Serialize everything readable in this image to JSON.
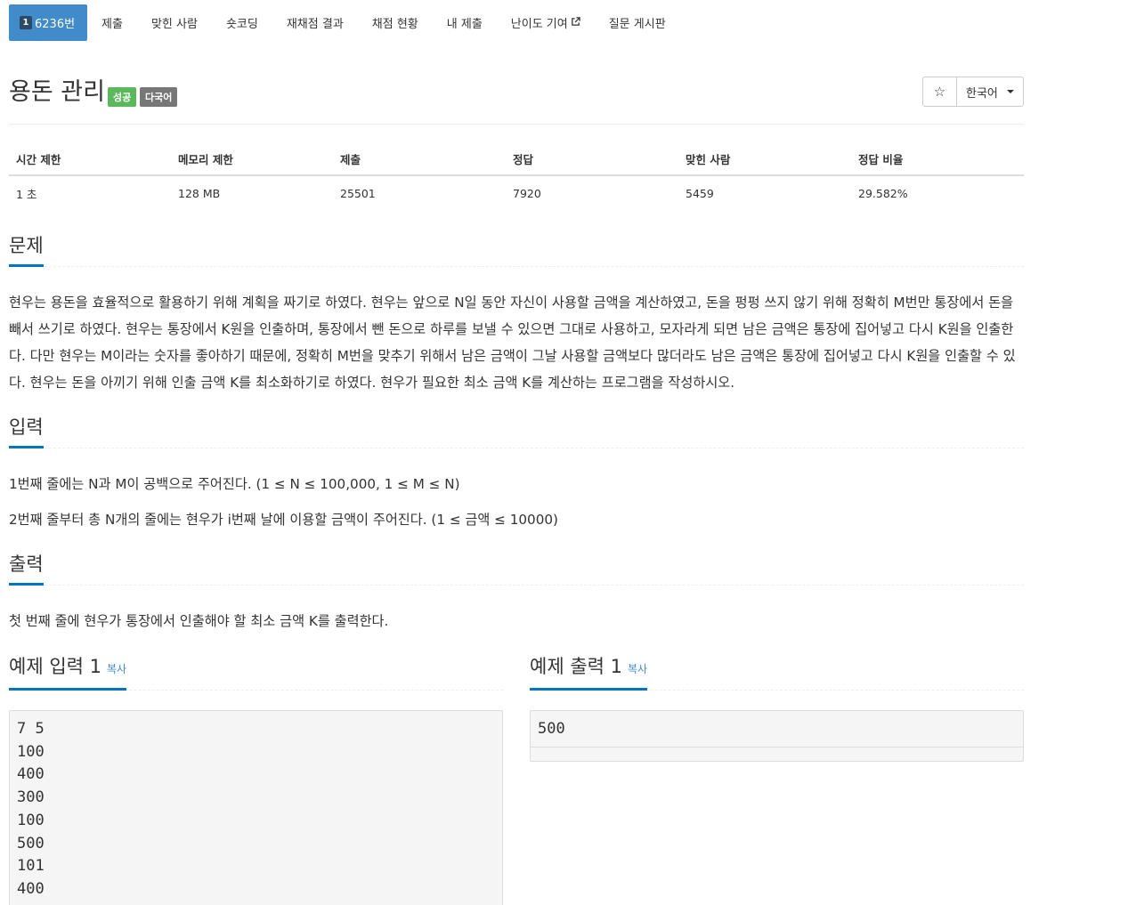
{
  "tabs": [
    {
      "label": "6236번",
      "badge": "1",
      "active": true
    },
    {
      "label": "제출"
    },
    {
      "label": "맞힌 사람"
    },
    {
      "label": "숏코딩"
    },
    {
      "label": "재채점 결과"
    },
    {
      "label": "채점 현황"
    },
    {
      "label": "내 제출"
    },
    {
      "label": "난이도 기여"
    },
    {
      "label": "질문 게시판"
    }
  ],
  "problem": {
    "title": "용돈 관리",
    "labels": {
      "status": "성공",
      "language": "다국어"
    },
    "star": "☆",
    "language_select": "한국어"
  },
  "info": {
    "headers": [
      "시간 제한",
      "메모리 제한",
      "제출",
      "정답",
      "맞힌 사람",
      "정답 비율"
    ],
    "values": [
      "1 초",
      "128 MB",
      "25501",
      "7920",
      "5459",
      "29.582%"
    ]
  },
  "sections": {
    "problem": {
      "heading": "문제",
      "text": "현우는 용돈을 효율적으로 활용하기 위해 계획을 짜기로 하였다. 현우는 앞으로 N일 동안 자신이 사용할 금액을 계산하였고, 돈을 펑펑 쓰지 않기 위해 정확히 M번만 통장에서 돈을 빼서 쓰기로 하였다. 현우는 통장에서 K원을 인출하며, 통장에서 뺀 돈으로 하루를 보낼 수 있으면 그대로 사용하고, 모자라게 되면 남은 금액은 통장에 집어넣고 다시 K원을 인출한다. 다만 현우는 M이라는 숫자를 좋아하기 때문에, 정확히 M번을 맞추기 위해서 남은 금액이 그날 사용할 금액보다 많더라도 남은 금액은 통장에 집어넣고 다시 K원을 인출할 수 있다. 현우는 돈을 아끼기 위해 인출 금액 K를 최소화하기로 하였다. 현우가 필요한 최소 금액 K를 계산하는 프로그램을 작성하시오."
    },
    "input": {
      "heading": "입력",
      "lines": [
        "1번째 줄에는 N과 M이 공백으로 주어진다. (1 ≤ N ≤ 100,000, 1 ≤ M ≤ N)",
        "2번째 줄부터 총 N개의 줄에는 현우가 i번째 날에 이용할 금액이 주어진다. (1 ≤ 금액 ≤ 10000)"
      ]
    },
    "output": {
      "heading": "출력",
      "text": "첫 번째 줄에 현우가 통장에서 인출해야 할 최소 금액 K를 출력한다."
    }
  },
  "samples": {
    "input": {
      "heading": "예제 입력 1",
      "copy": "복사",
      "content": "7 5\n100\n400\n300\n100\n500\n101\n400"
    },
    "output": {
      "heading": "예제 출력 1",
      "copy": "복사",
      "content": "500"
    }
  }
}
